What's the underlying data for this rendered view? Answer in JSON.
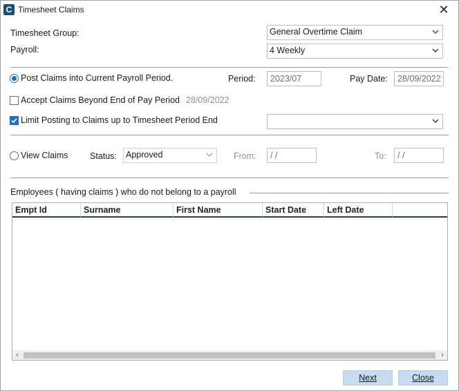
{
  "window": {
    "title": "Timesheet Claims",
    "icon_letter": "C"
  },
  "form": {
    "timesheet_group_label": "Timesheet Group:",
    "timesheet_group_value": "General Overtime Claim",
    "payroll_label": "Payroll:",
    "payroll_value": "4 Weekly",
    "post_claims_label": "Post Claims into Current Payroll Period.",
    "period_label": "Period:",
    "period_value": "2023/07",
    "pay_date_label": "Pay Date:",
    "pay_date_value": "28/09/2022",
    "accept_claims_label": "Accept Claims Beyond End of Pay Period",
    "accept_claims_date": "28/09/2022",
    "limit_posting_label": "Limit Posting to Claims up to Timesheet Period End",
    "limit_posting_value": "",
    "view_claims_label": "View Claims",
    "status_label": "Status:",
    "status_value": "Approved",
    "from_label": "From:",
    "from_value": "/  /",
    "to_label": "To:",
    "to_value": "/  /"
  },
  "employees_section": {
    "title": "Employees ( having claims ) who do not belong to a payroll",
    "columns": [
      "Empt Id",
      "Surname",
      "First Name",
      "Start Date",
      "Left Date"
    ],
    "rows": []
  },
  "buttons": {
    "next": "Next",
    "close": "Close"
  },
  "state": {
    "post_claims_selected": true,
    "view_claims_selected": false,
    "accept_claims_checked": false,
    "limit_posting_checked": true
  },
  "colors": {
    "accent": "#1f6fc6",
    "button": "#c7dcf0",
    "header_underline": "#1d3f6e"
  }
}
